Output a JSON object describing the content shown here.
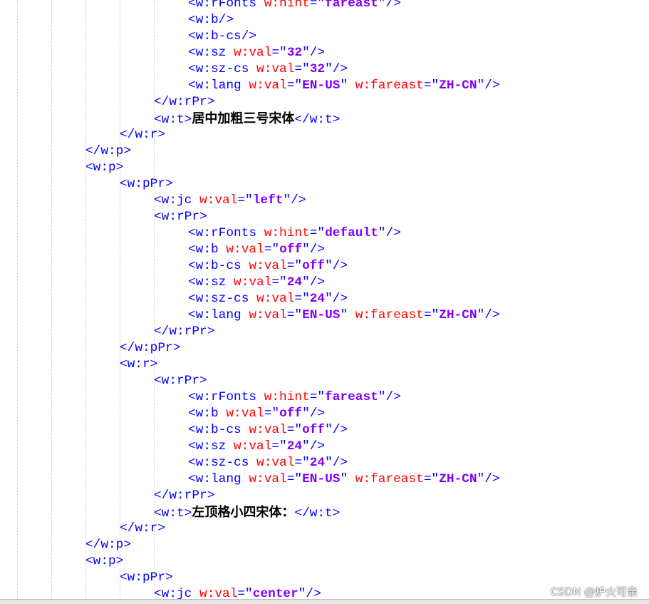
{
  "editor": {
    "lines": [
      {
        "indent": 6,
        "tokens": [
          [
            "b",
            "<w:rFonts "
          ],
          [
            "a",
            "w:hint"
          ],
          [
            "b",
            "=\""
          ],
          [
            "v",
            "fareast"
          ],
          [
            "b",
            "\"/>"
          ]
        ]
      },
      {
        "indent": 6,
        "tokens": [
          [
            "b",
            "<w:b/>"
          ]
        ]
      },
      {
        "indent": 6,
        "tokens": [
          [
            "b",
            "<w:b-cs/>"
          ]
        ]
      },
      {
        "indent": 6,
        "tokens": [
          [
            "b",
            "<w:sz "
          ],
          [
            "a",
            "w:val"
          ],
          [
            "b",
            "=\""
          ],
          [
            "v",
            "32"
          ],
          [
            "b",
            "\"/>"
          ]
        ]
      },
      {
        "indent": 6,
        "tokens": [
          [
            "b",
            "<w:sz-cs "
          ],
          [
            "a",
            "w:val"
          ],
          [
            "b",
            "=\""
          ],
          [
            "v",
            "32"
          ],
          [
            "b",
            "\"/>"
          ]
        ]
      },
      {
        "indent": 6,
        "tokens": [
          [
            "b",
            "<w:lang "
          ],
          [
            "a",
            "w:val"
          ],
          [
            "b",
            "=\""
          ],
          [
            "v",
            "EN-US"
          ],
          [
            "b",
            "\" "
          ],
          [
            "a",
            "w:fareast"
          ],
          [
            "b",
            "=\""
          ],
          [
            "v",
            "ZH-CN"
          ],
          [
            "b",
            "\"/>"
          ]
        ]
      },
      {
        "indent": 5,
        "tokens": [
          [
            "b",
            "</w:rPr>"
          ]
        ]
      },
      {
        "indent": 5,
        "tokens": [
          [
            "b",
            "<w:t>"
          ],
          [
            "t",
            "居中加粗三号宋体"
          ],
          [
            "b",
            "</w:t>"
          ]
        ]
      },
      {
        "indent": 4,
        "tokens": [
          [
            "b",
            "</w:r>"
          ]
        ]
      },
      {
        "indent": 3,
        "tokens": [
          [
            "b",
            "</w:p>"
          ]
        ]
      },
      {
        "indent": 3,
        "tokens": [
          [
            "b",
            "<w:p>"
          ]
        ]
      },
      {
        "indent": 4,
        "tokens": [
          [
            "b",
            "<w:pPr>"
          ]
        ]
      },
      {
        "indent": 5,
        "tokens": [
          [
            "b",
            "<w:jc "
          ],
          [
            "a",
            "w:val"
          ],
          [
            "b",
            "=\""
          ],
          [
            "v",
            "left"
          ],
          [
            "b",
            "\"/>"
          ]
        ]
      },
      {
        "indent": 5,
        "tokens": [
          [
            "b",
            "<w:rPr>"
          ]
        ]
      },
      {
        "indent": 6,
        "tokens": [
          [
            "b",
            "<w:rFonts "
          ],
          [
            "a",
            "w:hint"
          ],
          [
            "b",
            "=\""
          ],
          [
            "v",
            "default"
          ],
          [
            "b",
            "\"/>"
          ]
        ]
      },
      {
        "indent": 6,
        "tokens": [
          [
            "b",
            "<w:b "
          ],
          [
            "a",
            "w:val"
          ],
          [
            "b",
            "=\""
          ],
          [
            "v",
            "off"
          ],
          [
            "b",
            "\"/>"
          ]
        ]
      },
      {
        "indent": 6,
        "tokens": [
          [
            "b",
            "<w:b-cs "
          ],
          [
            "a",
            "w:val"
          ],
          [
            "b",
            "=\""
          ],
          [
            "v",
            "off"
          ],
          [
            "b",
            "\"/>"
          ]
        ]
      },
      {
        "indent": 6,
        "tokens": [
          [
            "b",
            "<w:sz "
          ],
          [
            "a",
            "w:val"
          ],
          [
            "b",
            "=\""
          ],
          [
            "v",
            "24"
          ],
          [
            "b",
            "\"/>"
          ]
        ]
      },
      {
        "indent": 6,
        "tokens": [
          [
            "b",
            "<w:sz-cs "
          ],
          [
            "a",
            "w:val"
          ],
          [
            "b",
            "=\""
          ],
          [
            "v",
            "24"
          ],
          [
            "b",
            "\"/>"
          ]
        ]
      },
      {
        "indent": 6,
        "tokens": [
          [
            "b",
            "<w:lang "
          ],
          [
            "a",
            "w:val"
          ],
          [
            "b",
            "=\""
          ],
          [
            "v",
            "EN-US"
          ],
          [
            "b",
            "\" "
          ],
          [
            "a",
            "w:fareast"
          ],
          [
            "b",
            "=\""
          ],
          [
            "v",
            "ZH-CN"
          ],
          [
            "b",
            "\"/>"
          ]
        ]
      },
      {
        "indent": 5,
        "tokens": [
          [
            "b",
            "</w:rPr>"
          ]
        ]
      },
      {
        "indent": 4,
        "tokens": [
          [
            "b",
            "</w:pPr>"
          ]
        ]
      },
      {
        "indent": 4,
        "tokens": [
          [
            "b",
            "<w:r>"
          ]
        ]
      },
      {
        "indent": 5,
        "tokens": [
          [
            "b",
            "<w:rPr>"
          ]
        ]
      },
      {
        "indent": 6,
        "tokens": [
          [
            "b",
            "<w:rFonts "
          ],
          [
            "a",
            "w:hint"
          ],
          [
            "b",
            "=\""
          ],
          [
            "v",
            "fareast"
          ],
          [
            "b",
            "\"/>"
          ]
        ]
      },
      {
        "indent": 6,
        "tokens": [
          [
            "b",
            "<w:b "
          ],
          [
            "a",
            "w:val"
          ],
          [
            "b",
            "=\""
          ],
          [
            "v",
            "off"
          ],
          [
            "b",
            "\"/>"
          ]
        ]
      },
      {
        "indent": 6,
        "tokens": [
          [
            "b",
            "<w:b-cs "
          ],
          [
            "a",
            "w:val"
          ],
          [
            "b",
            "=\""
          ],
          [
            "v",
            "off"
          ],
          [
            "b",
            "\"/>"
          ]
        ]
      },
      {
        "indent": 6,
        "tokens": [
          [
            "b",
            "<w:sz "
          ],
          [
            "a",
            "w:val"
          ],
          [
            "b",
            "=\""
          ],
          [
            "v",
            "24"
          ],
          [
            "b",
            "\"/>"
          ]
        ]
      },
      {
        "indent": 6,
        "tokens": [
          [
            "b",
            "<w:sz-cs "
          ],
          [
            "a",
            "w:val"
          ],
          [
            "b",
            "=\""
          ],
          [
            "v",
            "24"
          ],
          [
            "b",
            "\"/>"
          ]
        ]
      },
      {
        "indent": 6,
        "tokens": [
          [
            "b",
            "<w:lang "
          ],
          [
            "a",
            "w:val"
          ],
          [
            "b",
            "=\""
          ],
          [
            "v",
            "EN-US"
          ],
          [
            "b",
            "\" "
          ],
          [
            "a",
            "w:fareast"
          ],
          [
            "b",
            "=\""
          ],
          [
            "v",
            "ZH-CN"
          ],
          [
            "b",
            "\"/>"
          ]
        ]
      },
      {
        "indent": 5,
        "tokens": [
          [
            "b",
            "</w:rPr>"
          ]
        ]
      },
      {
        "indent": 5,
        "tokens": [
          [
            "b",
            "<w:t>"
          ],
          [
            "t",
            "左顶格小四宋体："
          ],
          [
            "b",
            "</w:t>"
          ]
        ]
      },
      {
        "indent": 4,
        "tokens": [
          [
            "b",
            "</w:r>"
          ]
        ]
      },
      {
        "indent": 3,
        "tokens": [
          [
            "b",
            "</w:p>"
          ]
        ]
      },
      {
        "indent": 3,
        "tokens": [
          [
            "b",
            "<w:p>"
          ]
        ]
      },
      {
        "indent": 4,
        "tokens": [
          [
            "b",
            "<w:pPr>"
          ]
        ]
      },
      {
        "indent": 5,
        "tokens": [
          [
            "b",
            "<w:jc "
          ],
          [
            "a",
            "w:val"
          ],
          [
            "b",
            "=\""
          ],
          [
            "v",
            "center"
          ],
          [
            "b",
            "\"/>"
          ]
        ]
      }
    ]
  },
  "watermark": "CSDN @炉火可亲"
}
